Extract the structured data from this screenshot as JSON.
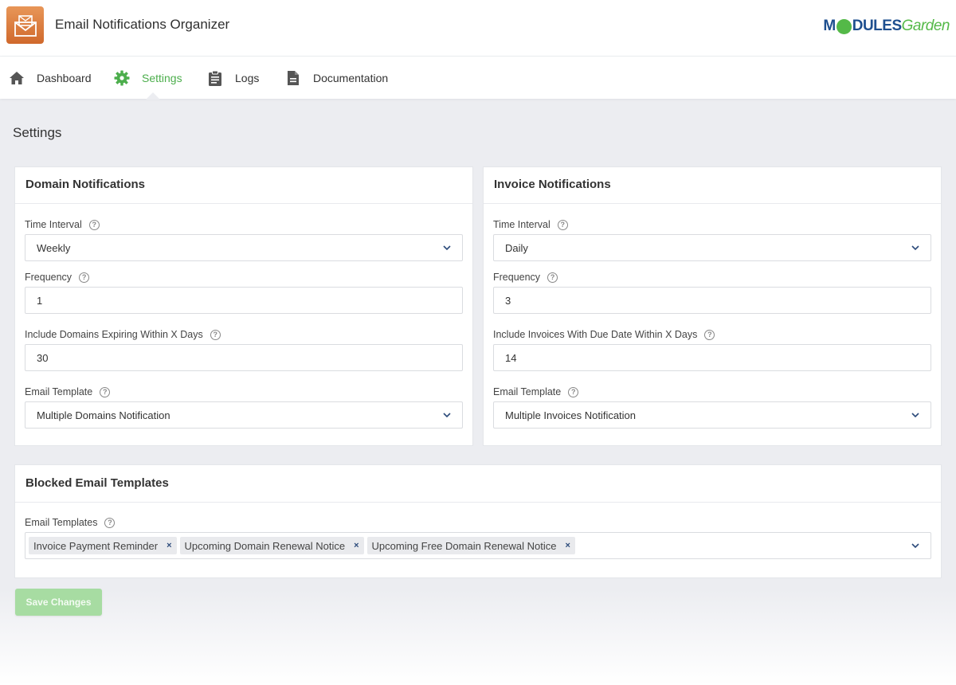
{
  "app": {
    "title": "Email Notifications Organizer",
    "brand_part1": "M",
    "brand_part2": "DULES",
    "brand_part3": "Garden"
  },
  "nav": {
    "items": [
      {
        "label": "Dashboard",
        "icon": "home-icon"
      },
      {
        "label": "Settings",
        "icon": "gear-icon",
        "active": true
      },
      {
        "label": "Logs",
        "icon": "clipboard-icon"
      },
      {
        "label": "Documentation",
        "icon": "document-icon"
      }
    ]
  },
  "page": {
    "title": "Settings"
  },
  "domain": {
    "heading": "Domain Notifications",
    "time_interval_label": "Time Interval",
    "time_interval_value": "Weekly",
    "frequency_label": "Frequency",
    "frequency_value": "1",
    "expiring_label": "Include Domains Expiring Within X Days",
    "expiring_value": "30",
    "template_label": "Email Template",
    "template_value": "Multiple Domains Notification"
  },
  "invoice": {
    "heading": "Invoice Notifications",
    "time_interval_label": "Time Interval",
    "time_interval_value": "Daily",
    "frequency_label": "Frequency",
    "frequency_value": "3",
    "due_label": "Include Invoices With Due Date Within X Days",
    "due_value": "14",
    "template_label": "Email Template",
    "template_value": "Multiple Invoices Notification"
  },
  "blocked": {
    "heading": "Blocked Email Templates",
    "label": "Email Templates",
    "tags": [
      "Invoice Payment Reminder",
      "Upcoming Domain Renewal Notice",
      "Upcoming Free Domain Renewal Notice"
    ]
  },
  "actions": {
    "save_label": "Save Changes"
  },
  "colors": {
    "accent": "#4cae4c",
    "brand_blue": "#1e4f8f",
    "logo_orange": "#d97a3a"
  }
}
